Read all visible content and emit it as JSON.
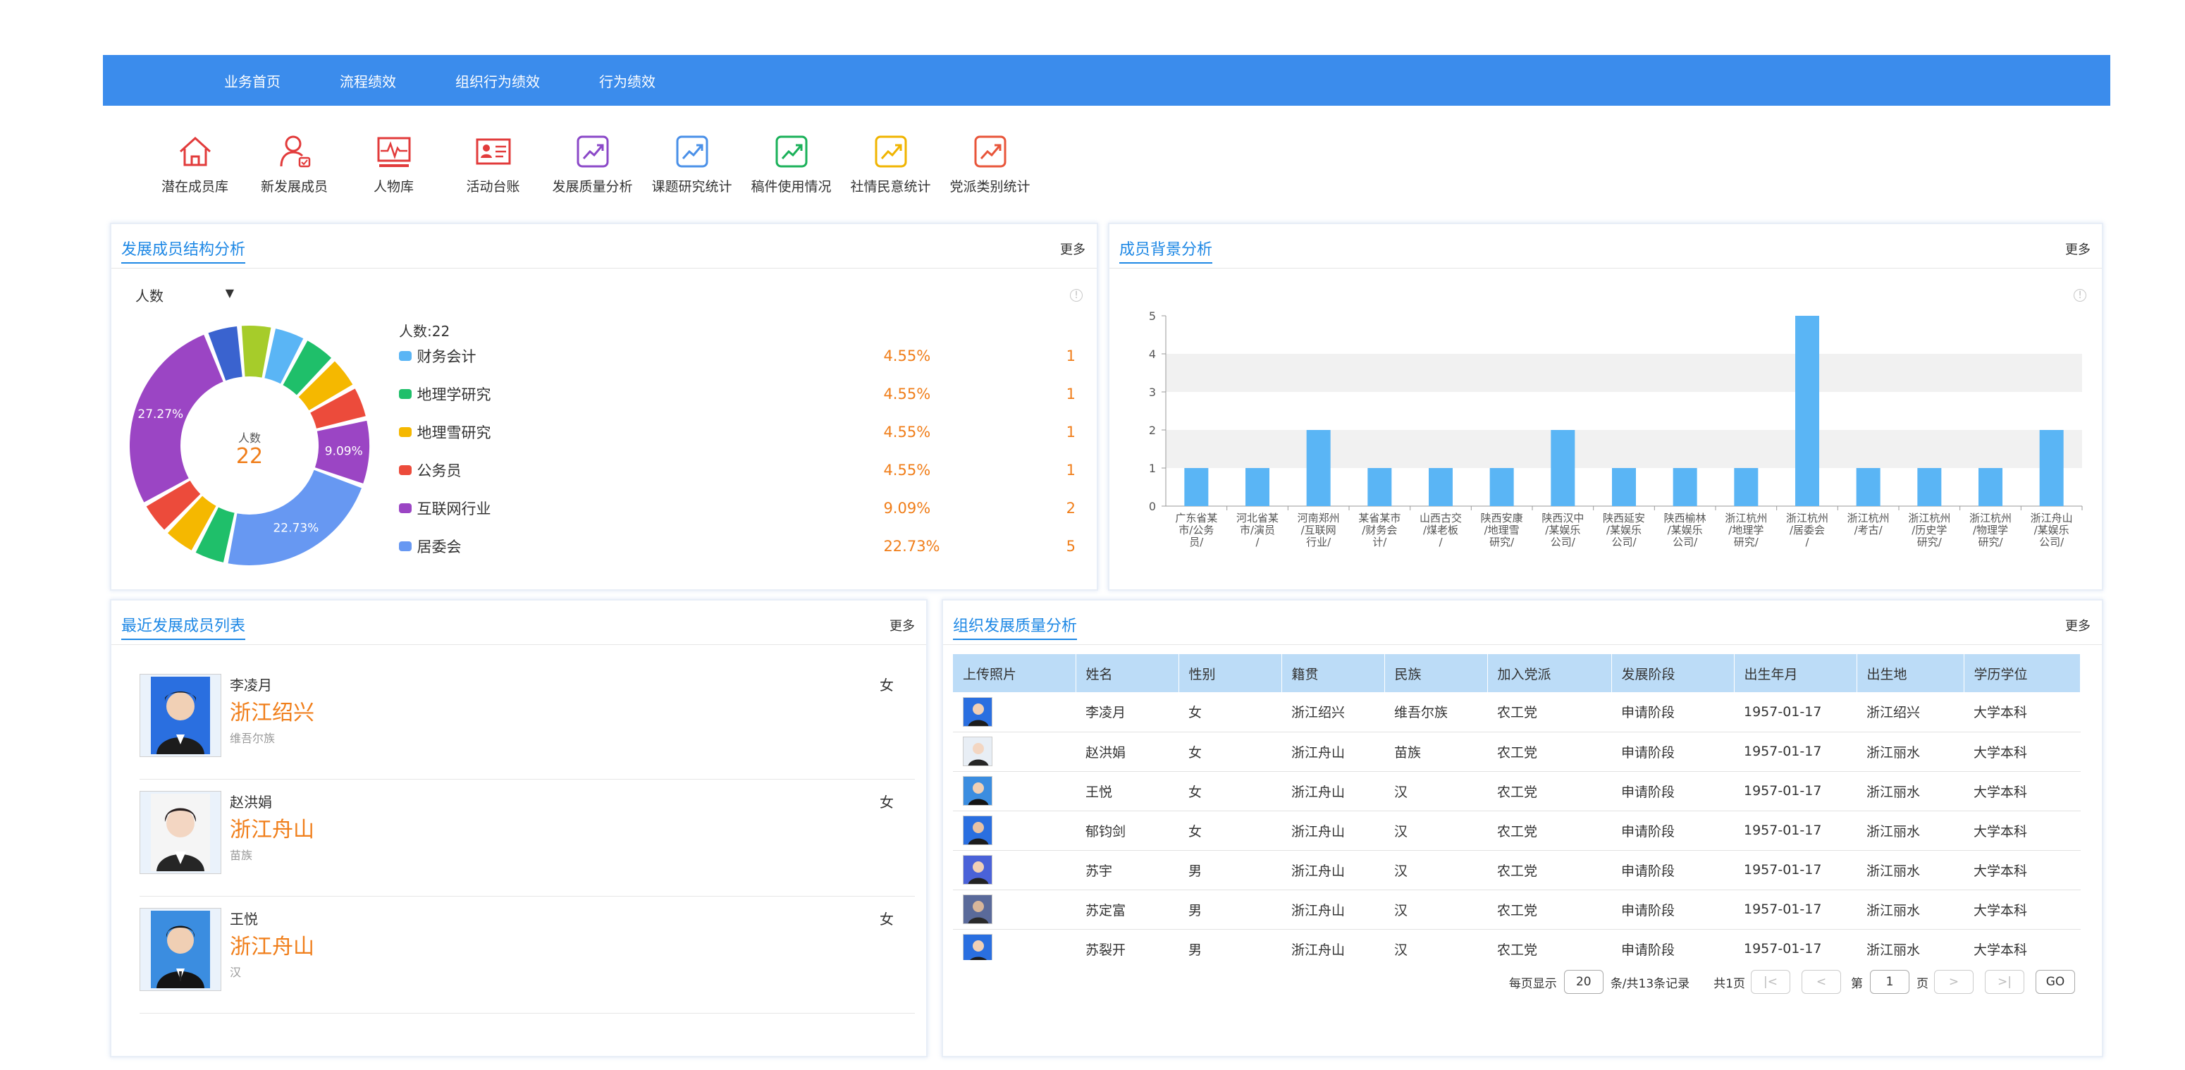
{
  "nav": [
    "业务首页",
    "流程绩效",
    "组织行为绩效",
    "行为绩效"
  ],
  "shortcuts": [
    {
      "label": "潜在成员库",
      "icon": "home-icon",
      "color": "#e23b3b"
    },
    {
      "label": "新发展成员",
      "icon": "user-add-icon",
      "color": "#e23b3b"
    },
    {
      "label": "人物库",
      "icon": "pulse-icon",
      "color": "#e23b3b"
    },
    {
      "label": "活动台账",
      "icon": "id-card-icon",
      "color": "#e23b3b"
    },
    {
      "label": "发展质量分析",
      "icon": "trend-icon",
      "color": "#8b48c8"
    },
    {
      "label": "课题研究统计",
      "icon": "trend-icon",
      "color": "#4a90e8"
    },
    {
      "label": "稿件使用情况",
      "icon": "trend-icon",
      "color": "#1bb15a"
    },
    {
      "label": "社情民意统计",
      "icon": "trend-icon",
      "color": "#f0b400"
    },
    {
      "label": "党派类别统计",
      "icon": "trend-icon",
      "color": "#e8553a"
    }
  ],
  "structure": {
    "title": "发展成员结构分析",
    "more": "更多",
    "select": "人数",
    "center_label": "人数",
    "center_value": "22",
    "total": "人数:22",
    "legend": [
      {
        "name": "财务会计",
        "pct": "4.55%",
        "count": "1",
        "color": "#5ab5f5"
      },
      {
        "name": "地理学研究",
        "pct": "4.55%",
        "count": "1",
        "color": "#1fbf6a"
      },
      {
        "name": "地理雪研究",
        "pct": "4.55%",
        "count": "1",
        "color": "#f5b800"
      },
      {
        "name": "公务员",
        "pct": "4.55%",
        "count": "1",
        "color": "#ec4b3b"
      },
      {
        "name": "互联网行业",
        "pct": "9.09%",
        "count": "2",
        "color": "#9b45c4"
      },
      {
        "name": "居委会",
        "pct": "22.73%",
        "count": "5",
        "color": "#6798f2"
      }
    ]
  },
  "chart_data": [
    {
      "type": "pie",
      "title": "发展成员结构分析",
      "slices": [
        {
          "label": "财务会计",
          "value": 1,
          "color": "#5ab5f5"
        },
        {
          "label": "地理学研究",
          "value": 1,
          "color": "#1fbf6a"
        },
        {
          "label": "地理雪研究",
          "value": 1,
          "color": "#f5b800"
        },
        {
          "label": "公务员",
          "value": 1,
          "color": "#ec4b3b"
        },
        {
          "label": "互联网行业",
          "value": 2,
          "color": "#9b45c4"
        },
        {
          "label": "居委会",
          "value": 5,
          "color": "#6798f2"
        },
        {
          "label": "",
          "value": 1,
          "color": "#1fbf6a"
        },
        {
          "label": "",
          "value": 1,
          "color": "#f5b800"
        },
        {
          "label": "",
          "value": 1,
          "color": "#ec4b3b"
        },
        {
          "label": "",
          "value": 6,
          "color": "#9b45c4"
        },
        {
          "label": "",
          "value": 1,
          "color": "#3a63cf"
        },
        {
          "label": "",
          "value": 1,
          "color": "#a6cc2a"
        }
      ],
      "data_labels": [
        "9.09%",
        "22.73%",
        "27.27%"
      ]
    },
    {
      "type": "bar",
      "title": "成员背景分析",
      "categories": [
        "广东省某市/公务员/",
        "河北省某市/演员/",
        "河南郑州/互联网行业/",
        "某省某市/财务会计/",
        "山西古交/煤老板/",
        "陕西安康/地理雪研究/",
        "陕西汉中/某娱乐公司/",
        "陕西延安/某娱乐公司/",
        "陕西榆林/某娱乐公司/",
        "浙江杭州/地理学研究/",
        "浙江杭州/居委会/",
        "浙江杭州/考古/",
        "浙江杭州/历史学研究/",
        "浙江杭州/物理学研究/",
        "浙江舟山/某娱乐公司/"
      ],
      "values": [
        1,
        1,
        2,
        1,
        1,
        1,
        2,
        1,
        1,
        1,
        5,
        1,
        1,
        1,
        2
      ],
      "ylim": [
        0,
        5
      ],
      "yticks": [
        0,
        1,
        2,
        3,
        4,
        5
      ],
      "color": "#5ab5f5"
    }
  ],
  "background": {
    "title": "成员背景分析",
    "more": "更多"
  },
  "recent": {
    "title": "最近发展成员列表",
    "more": "更多",
    "members": [
      {
        "name": "李凌月",
        "sex": "女",
        "place": "浙江绍兴",
        "ethnic": "维吾尔族"
      },
      {
        "name": "赵洪娟",
        "sex": "女",
        "place": "浙江舟山",
        "ethnic": "苗族"
      },
      {
        "name": "王悦",
        "sex": "女",
        "place": "浙江舟山",
        "ethnic": "汉"
      }
    ]
  },
  "quality": {
    "title": "组织发展质量分析",
    "more": "更多",
    "columns": [
      "上传照片",
      "姓名",
      "性别",
      "籍贯",
      "民族",
      "加入党派",
      "发展阶段",
      "出生年月",
      "出生地",
      "学历学位"
    ],
    "rows": [
      [
        "李凌月",
        "女",
        "浙江绍兴",
        "维吾尔族",
        "农工党",
        "申请阶段",
        "1957-01-17",
        "浙江绍兴",
        "大学本科"
      ],
      [
        "赵洪娟",
        "女",
        "浙江舟山",
        "苗族",
        "农工党",
        "申请阶段",
        "1957-01-17",
        "浙江丽水",
        "大学本科"
      ],
      [
        "王悦",
        "女",
        "浙江舟山",
        "汉",
        "农工党",
        "申请阶段",
        "1957-01-17",
        "浙江丽水",
        "大学本科"
      ],
      [
        "郁钧剑",
        "女",
        "浙江舟山",
        "汉",
        "农工党",
        "申请阶段",
        "1957-01-17",
        "浙江丽水",
        "大学本科"
      ],
      [
        "苏宇",
        "男",
        "浙江舟山",
        "汉",
        "农工党",
        "申请阶段",
        "1957-01-17",
        "浙江丽水",
        "大学本科"
      ],
      [
        "苏定富",
        "男",
        "浙江舟山",
        "汉",
        "农工党",
        "申请阶段",
        "1957-01-17",
        "浙江丽水",
        "大学本科"
      ],
      [
        "苏裂开",
        "男",
        "浙江舟山",
        "汉",
        "农工党",
        "申请阶段",
        "1957-01-17",
        "浙江丽水",
        "大学本科"
      ]
    ],
    "pager": {
      "per_page_label": "每页显示",
      "per_page": "20",
      "records": "条/共13条记录",
      "pages": "共1页",
      "page_prefix": "第",
      "page": "1",
      "page_suffix": "页",
      "go": "GO"
    }
  }
}
